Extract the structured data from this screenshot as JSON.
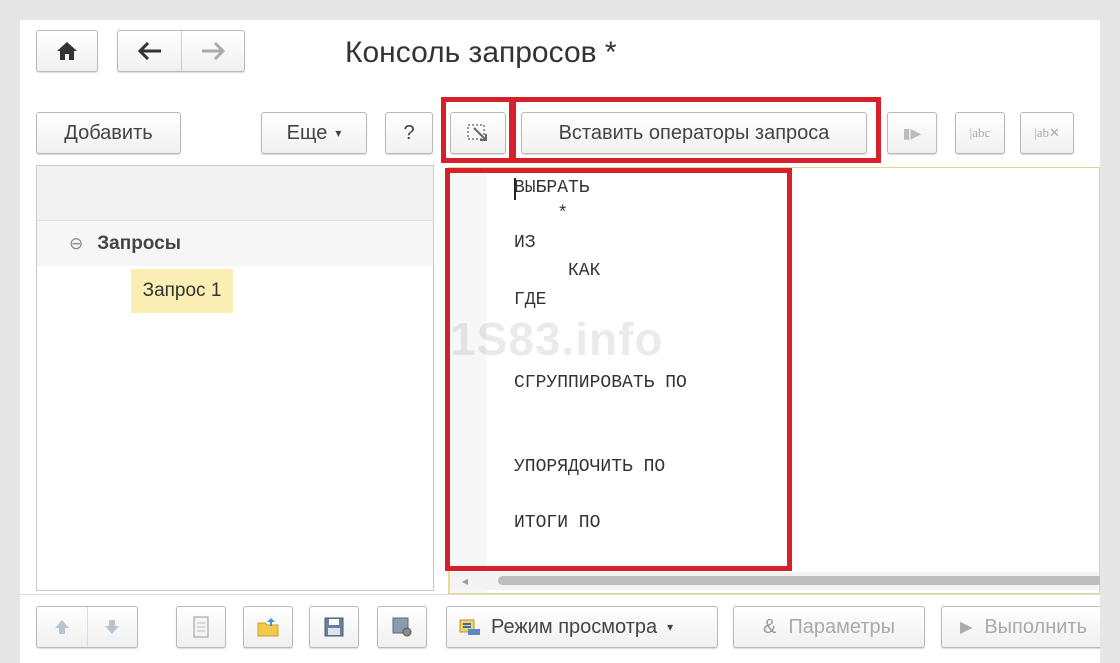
{
  "window": {
    "title": "Консоль запросов *"
  },
  "nav": {
    "home_icon": "home-icon",
    "back_icon": "arrow-left-icon",
    "forward_icon": "arrow-right-icon"
  },
  "toolbar": {
    "add_label": "Добавить",
    "more_label": "Еще",
    "help_label": "?",
    "insert_operators_label": "Вставить операторы запроса"
  },
  "tree": {
    "group_label": "Запросы",
    "items": [
      {
        "label": "Запрос 1"
      }
    ]
  },
  "editor": {
    "lines": [
      {
        "text": "ВЫБРАТЬ"
      },
      {
        "text": "    *"
      },
      {
        "text": "ИЗ"
      },
      {
        "text": "     КАК"
      },
      {
        "text": "ГДЕ"
      },
      {
        "text": "СГРУППИРОВАТЬ ПО"
      },
      {
        "text": "УПОРЯДОЧИТЬ ПО"
      },
      {
        "text": "ИТОГИ ПО"
      }
    ],
    "watermark": "1S83.info"
  },
  "bottom": {
    "view_mode_label": "Режим просмотра",
    "params_label": "Параметры",
    "run_label": "Выполнить"
  },
  "colors": {
    "highlight": "#d8202b",
    "selected_item": "#fbeeb3",
    "editor_border": "#e2d689"
  }
}
